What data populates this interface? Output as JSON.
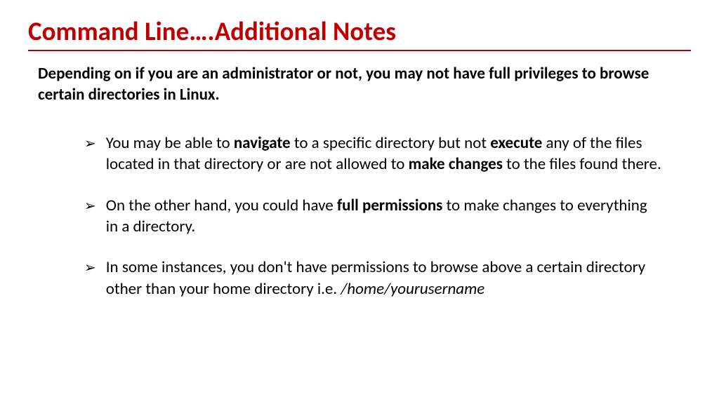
{
  "title": "Command Line….Additional Notes",
  "intro": "Depending on if you are an administrator or not, you may not have full privileges to browse certain directories in Linux.",
  "bullets": [
    {
      "html": "You may be able to <b>navigate</b> to a specific directory but not <b>execute</b> any of the files located in that directory or are not allowed to <b>make changes</b> to the files found there."
    },
    {
      "html": "On the other hand, you could have <b>full permissions</b> to make changes to everything in a directory."
    },
    {
      "html": "In some instances, you don't have permissions to browse above a certain directory other than your home directory i.e. <i>/home/yourusername</i>"
    }
  ],
  "bullet_glyph": "➢"
}
